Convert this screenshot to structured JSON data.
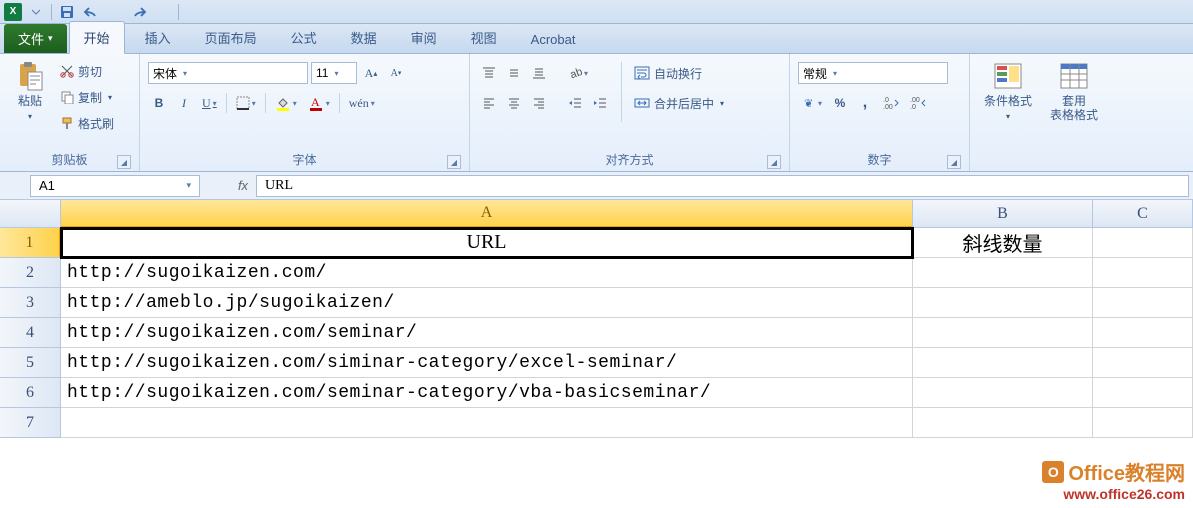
{
  "qat": {
    "app": "X"
  },
  "tabs": {
    "file": "文件",
    "items": [
      "开始",
      "插入",
      "页面布局",
      "公式",
      "数据",
      "审阅",
      "视图",
      "Acrobat"
    ],
    "active_index": 0
  },
  "ribbon": {
    "clipboard": {
      "paste": "粘贴",
      "cut": "剪切",
      "copy": "复制",
      "format_painter": "格式刷",
      "label": "剪贴板"
    },
    "font": {
      "name": "宋体",
      "size": "11",
      "bold": "B",
      "italic": "I",
      "underline": "U",
      "label": "字体"
    },
    "alignment": {
      "wrap": "自动换行",
      "merge": "合并后居中",
      "label": "对齐方式"
    },
    "number": {
      "format": "常规",
      "label": "数字"
    },
    "styles": {
      "cond_format": "条件格式",
      "table_format": "套用\n表格格式"
    }
  },
  "namebox": "A1",
  "formula": "URL",
  "columns": [
    "A",
    "B",
    "C"
  ],
  "rows": [
    {
      "n": "1",
      "A": "URL",
      "B": "斜线数量",
      "header": true
    },
    {
      "n": "2",
      "A": "http://sugoikaizen.com/",
      "B": ""
    },
    {
      "n": "3",
      "A": "http://ameblo.jp/sugoikaizen/",
      "B": ""
    },
    {
      "n": "4",
      "A": "http://sugoikaizen.com/seminar/",
      "B": ""
    },
    {
      "n": "5",
      "A": "http://sugoikaizen.com/siminar-category/excel-seminar/",
      "B": ""
    },
    {
      "n": "6",
      "A": "http://sugoikaizen.com/seminar-category/vba-basicseminar/",
      "B": ""
    },
    {
      "n": "7",
      "A": "",
      "B": ""
    }
  ],
  "watermark": {
    "line1": "Office教程网",
    "line2": "www.office26.com"
  }
}
